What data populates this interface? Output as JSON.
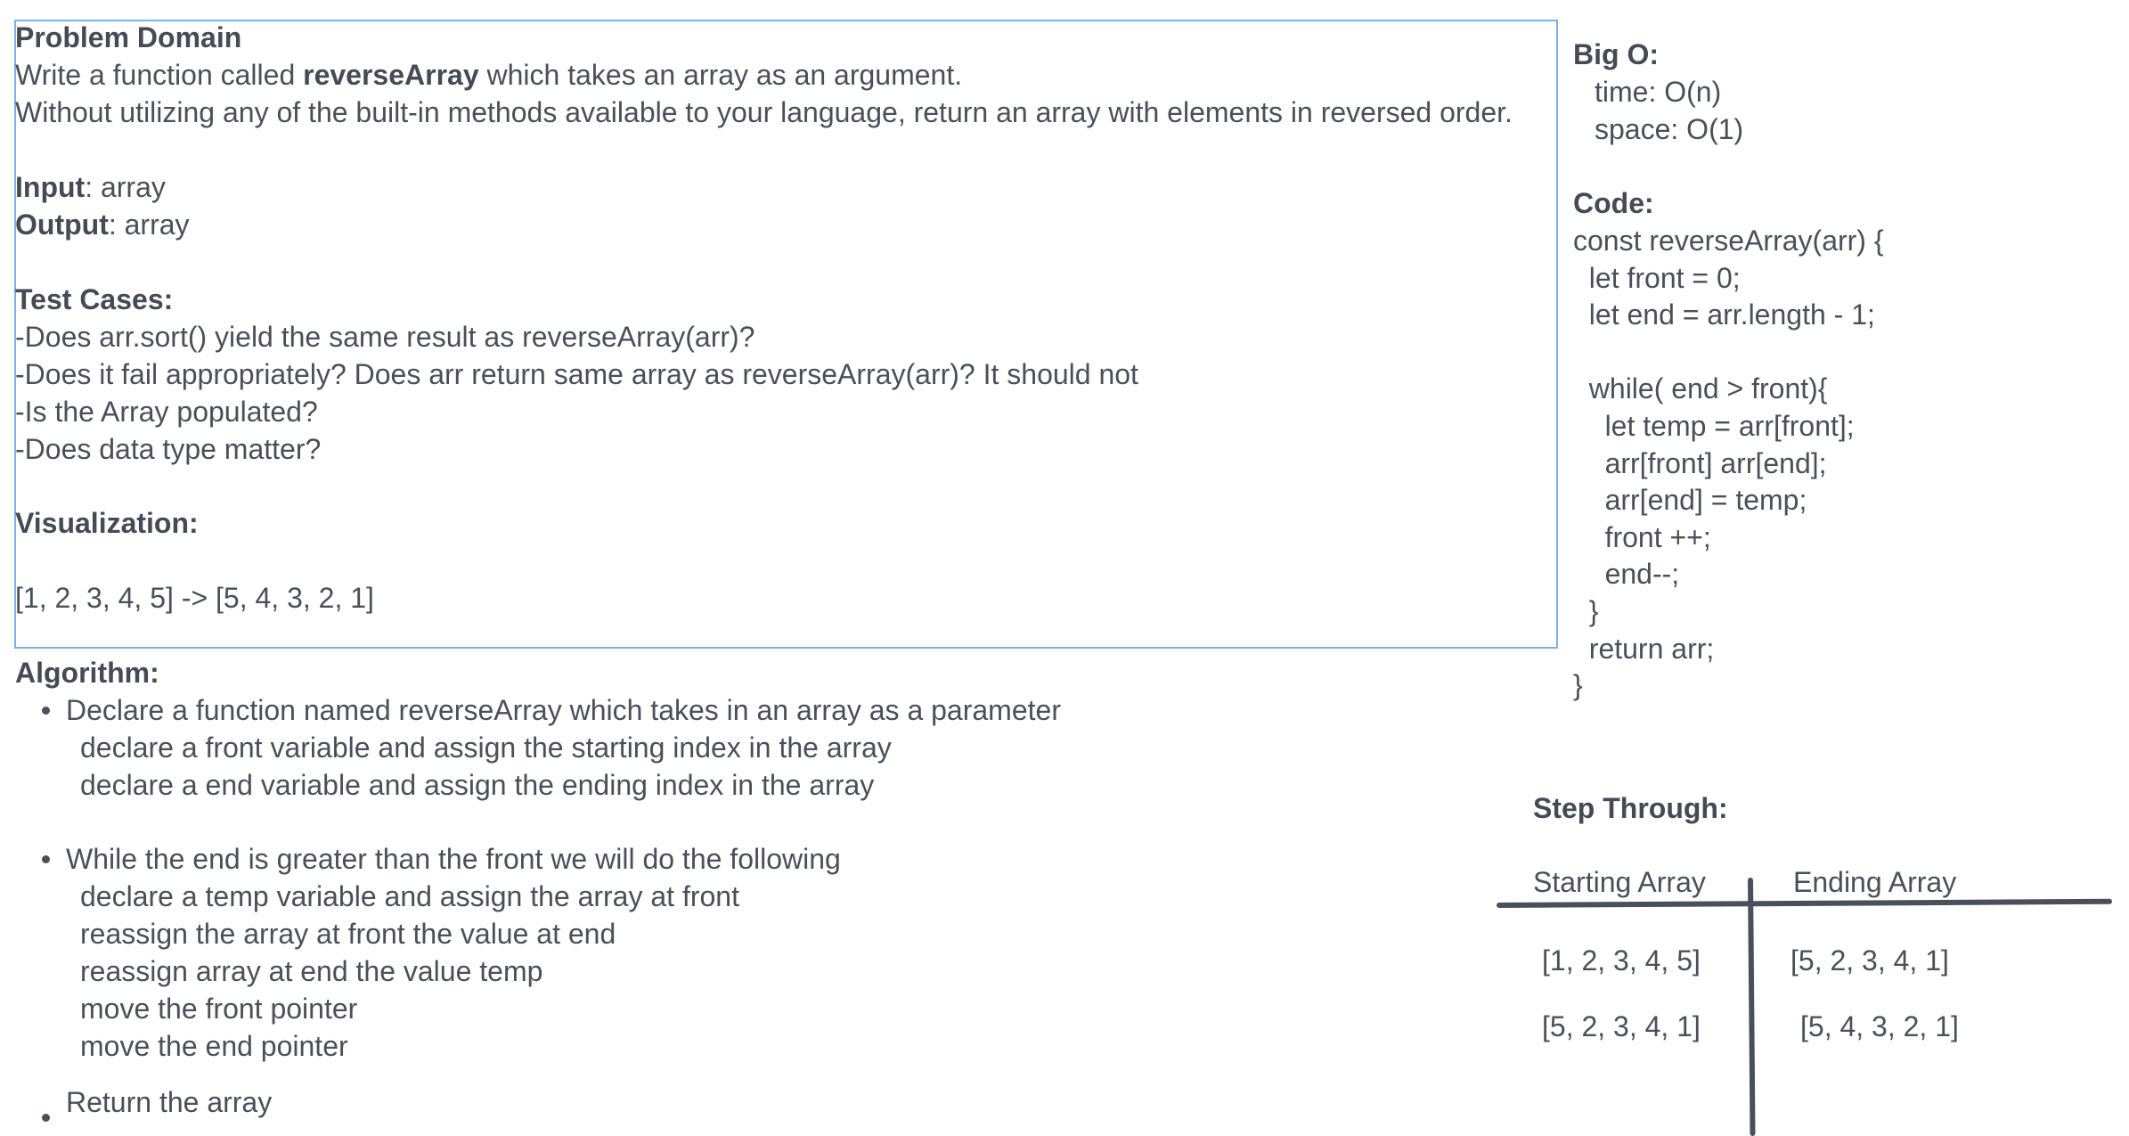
{
  "problem": {
    "heading": "Problem Domain",
    "desc_prefix": "Write a function called ",
    "desc_bold": "reverseArray",
    "desc_suffix": " which takes an array as an argument.",
    "desc2": "Without utilizing any of the built-in methods available to your language, return an array with elements in reversed order.",
    "input_label": "Input",
    "input_value": ": array",
    "output_label": "Output",
    "output_value": ": array",
    "test_heading": "Test Cases:",
    "tests": [
      "-Does arr.sort() yield the same result as reverseArray(arr)?",
      "-Does it fail appropriately? Does arr return same array as reverseArray(arr)? It should not",
      "-Is the Array populated?",
      "-Does data type matter?"
    ],
    "viz_heading": "Visualization:",
    "viz_text": "[1, 2, 3, 4, 5] -> [5, 4, 3, 2, 1]"
  },
  "algorithm": {
    "heading": "Algorithm:",
    "bullets": [
      {
        "text": "Declare a function named reverseArray which takes in an array as a parameter",
        "subs": [
          "declare a front variable and assign the starting index in the array",
          "declare a end variable and assign the ending index in the array"
        ]
      },
      {
        "text": "While the end is greater than the front we will do the following",
        "subs": [
          "declare a temp variable and assign the array at front",
          "reassign the array at front the value at end",
          "reassign array at end the value temp",
          "move the front pointer",
          "move the end pointer"
        ]
      },
      {
        "text": "Return the array",
        "subs": []
      }
    ]
  },
  "bigo": {
    "heading": "Big O:",
    "time": "time: O(n)",
    "space": "space: O(1)"
  },
  "code": {
    "heading": "Code:",
    "lines": [
      "const reverseArray(arr) {",
      "  let front = 0;",
      "  let end = arr.length - 1;",
      "",
      "  while( end > front){",
      "    let temp = arr[front];",
      "    arr[front] arr[end];",
      "    arr[end] = temp;",
      "    front ++;",
      "    end--;",
      "  }",
      "  return arr;",
      "}"
    ]
  },
  "step_through": {
    "heading": "Step Through:",
    "col_start": "Starting Array",
    "col_end": "Ending Array",
    "rows": [
      {
        "start": "[1, 2, 3, 4, 5]",
        "end": "[5, 2, 3, 4, 1]"
      },
      {
        "start": "[5, 2, 3, 4, 1]",
        "end": "[5, 4, 3, 2, 1]"
      }
    ]
  },
  "colors": {
    "text": "#4a4f5a",
    "frame": "#7bb0e6"
  }
}
